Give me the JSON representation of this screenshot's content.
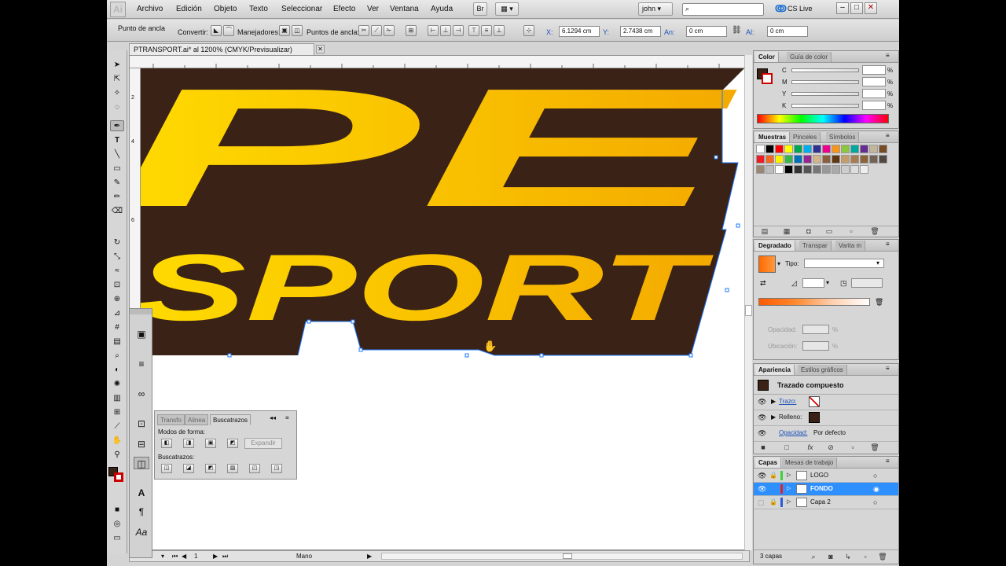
{
  "app": {
    "logo": "Ai"
  },
  "menu": [
    "Archivo",
    "Edición",
    "Objeto",
    "Texto",
    "Seleccionar",
    "Efecto",
    "Ver",
    "Ventana",
    "Ayuda"
  ],
  "menubar": {
    "user": "john",
    "cs_live": "CS Live",
    "br_label": "Br"
  },
  "control": {
    "anchor_label": "Punto de ancla",
    "convert_label": "Convertir:",
    "handles_label": "Manejadores:",
    "anchors_label": "Puntos de ancla:",
    "x_label": "X:",
    "x_value": "6.1294 cm",
    "y_label": "Y:",
    "y_value": "2.7438 cm",
    "w_label": "An:",
    "w_value": "0 cm",
    "h_label": "Al:",
    "h_value": "0 cm"
  },
  "document": {
    "tab_title": "PTRANSPORT.ai* al 1200% (CMYK/Previsualizar)",
    "artwork_text_top": "PE",
    "artwork_text_bottom": "SPORT",
    "zoom": "1200%",
    "page": "1",
    "status_tool": "Mano",
    "ruler_v": [
      "2",
      "4",
      "6"
    ]
  },
  "colors": {
    "accent_yellow": "#ffd400",
    "accent_orange": "#f5a800",
    "dark_brown": "#3a2216",
    "selection_blue": "#1e78ff",
    "layer_selected": "#2e8fff"
  },
  "pathfinder": {
    "tabs": [
      "Transfo",
      "Alinea",
      "Buscatrazos"
    ],
    "modes_label": "Modos de forma:",
    "expand_button": "Expandir",
    "pathfinders_label": "Buscatrazos:"
  },
  "color_panel": {
    "tabs": [
      "Color",
      "Guía de color"
    ],
    "channels": [
      "C",
      "M",
      "Y",
      "K"
    ],
    "unit": "%"
  },
  "swatches_panel": {
    "tabs": [
      "Muestras",
      "Pinceles",
      "Símbolos"
    ]
  },
  "gradient_panel": {
    "tabs": [
      "Degradado",
      "Transpar",
      "Varita m"
    ],
    "type_label": "Tipo:",
    "opacity_label": "Opacidad:",
    "location_label": "Ubicación:",
    "unit": "%"
  },
  "appearance_panel": {
    "tabs": [
      "Apariencia",
      "Estilos gráficos"
    ],
    "title": "Trazado compuesto",
    "stroke_label": "Trazo:",
    "fill_label": "Relleno:",
    "opacity_label": "Opacidad:",
    "opacity_value": "Por defecto"
  },
  "layers_panel": {
    "tabs": [
      "Capas",
      "Mesas de trabajo"
    ],
    "layers": [
      "LOGO",
      "FONDO",
      "Capa 2"
    ],
    "footer": "3 capas"
  }
}
